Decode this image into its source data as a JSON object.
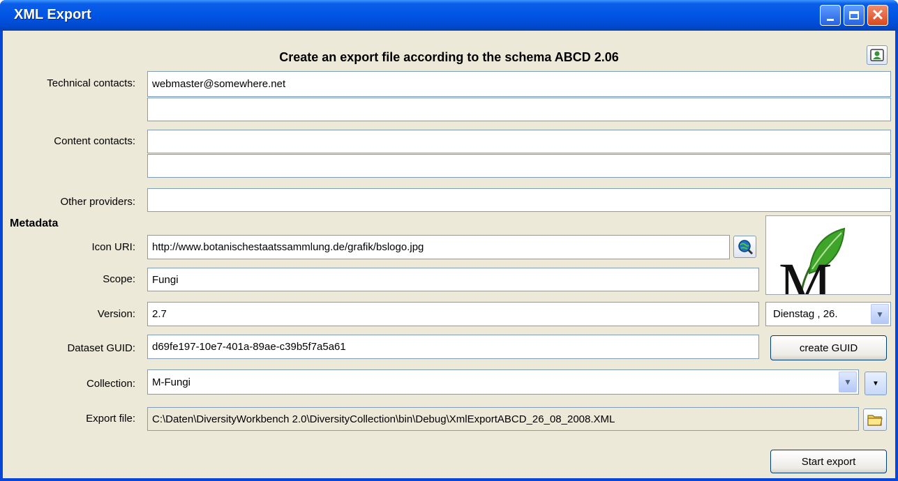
{
  "window": {
    "title": "XML Export"
  },
  "header": {
    "title": "Create an export file according to the schema ABCD 2.06"
  },
  "labels": {
    "technical_contacts": "Technical contacts:",
    "content_contacts": "Content contacts:",
    "other_providers": "Other providers:",
    "metadata": "Metadata",
    "icon_uri": "Icon URI:",
    "scope": "Scope:",
    "version": "Version:",
    "dataset_guid": "Dataset GUID:",
    "collection": "Collection:",
    "export_file": "Export file:"
  },
  "fields": {
    "technical_contact_1": "webmaster@somewhere.net",
    "technical_contact_2": "",
    "content_contact_1": "",
    "content_contact_2": "",
    "other_providers": "",
    "icon_uri": "http://www.botanischestaatssammlung.de/grafik/bslogo.jpg",
    "scope": "Fungi",
    "version": "2.7",
    "version_date": "Dienstag  , 26.",
    "dataset_guid": "d69fe197-10e7-401a-89ae-c39b5f7a5a61",
    "collection": "M-Fungi",
    "export_file": "C:\\Daten\\DiversityWorkbench 2.0\\DiversityCollection\\bin\\Debug\\XmlExportABCD_26_08_2008.XML"
  },
  "buttons": {
    "create_guid": "create GUID",
    "start_export": "Start export"
  },
  "logo": {
    "letter": "M"
  },
  "icons": {
    "minimize": "minimize-icon",
    "maximize": "maximize-icon",
    "close": "close-icon",
    "contact": "contact-card-icon",
    "preview": "globe-search-icon",
    "folder": "folder-icon",
    "dropdown": "chevron-down-icon",
    "leaf": "leaf-icon"
  },
  "colors": {
    "titlebar": "#0055e5",
    "window_bg": "#ece9d8",
    "field_border": "#7f9db9",
    "leaf_green": "#3fa52a"
  }
}
